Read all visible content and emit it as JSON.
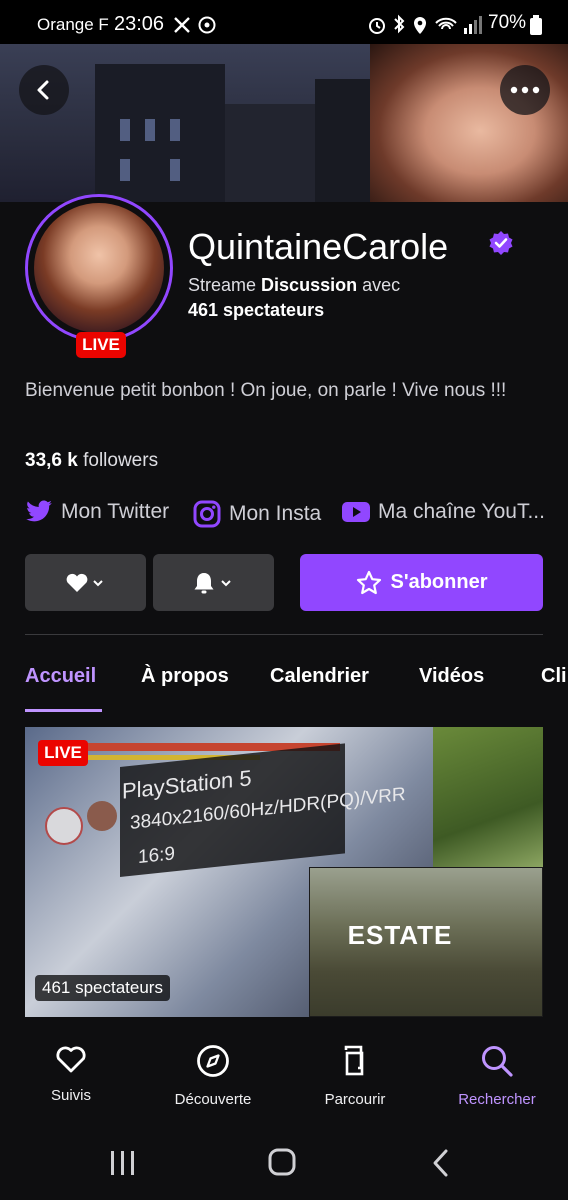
{
  "status_bar": {
    "carrier": "Orange F",
    "time": "23:06",
    "battery": "70%"
  },
  "icons": {
    "back": "back-arrow-icon",
    "more": "more-dots-icon",
    "verified": "verified-badge-icon",
    "twitter": "twitter-icon",
    "instagram": "instagram-icon",
    "youtube": "youtube-icon",
    "heart": "heart-icon",
    "bell": "bell-icon",
    "star": "star-icon"
  },
  "profile": {
    "channel_name": "QuintaineCarole",
    "live_badge": "LIVE",
    "streaming_prefix": "Streame",
    "category": "Discussion",
    "streaming_suffix": "avec",
    "viewers": "461 spectateurs",
    "bio": "Bienvenue petit bonbon ! On joue, on parle ! Vive nous !!!",
    "followers_count": "33,6 k",
    "followers_label": "followers"
  },
  "social_links": [
    {
      "label": "Mon Twitter"
    },
    {
      "label": "Mon Insta"
    },
    {
      "label": "Ma chaîne YouT..."
    }
  ],
  "actions": {
    "subscribe_label": "S'abonner"
  },
  "tabs": [
    {
      "label": "Accueil",
      "active": true
    },
    {
      "label": "À propos"
    },
    {
      "label": "Calendrier"
    },
    {
      "label": "Vidéos"
    },
    {
      "label": "Cli"
    }
  ],
  "video": {
    "live_badge": "LIVE",
    "overlay_lines": [
      "PlayStation 5",
      "3840x2160/60Hz/HDR(PQ)/VRR",
      "16:9"
    ],
    "minimap_label": "ESTATE",
    "viewers": "461 spectateurs"
  },
  "bottom_nav": [
    {
      "label": "Suivis"
    },
    {
      "label": "Découverte"
    },
    {
      "label": "Parcourir"
    },
    {
      "label": "Rechercher",
      "active": true
    }
  ],
  "colors": {
    "accent": "#9147ff",
    "accent_light": "#bf94ff",
    "live": "#eb0400",
    "background": "#0e0e10"
  }
}
